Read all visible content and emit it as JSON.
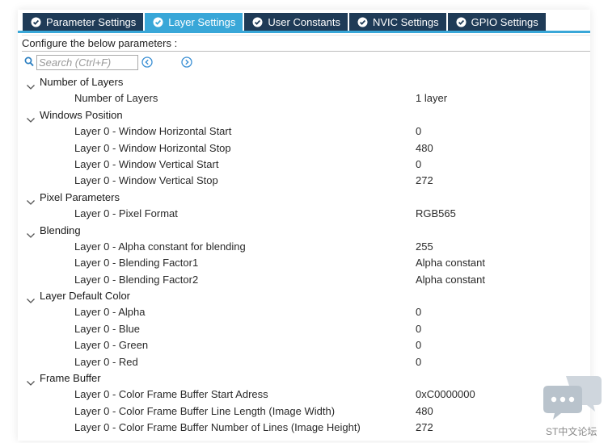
{
  "tabs": [
    {
      "label": "Parameter Settings",
      "active": false
    },
    {
      "label": "Layer Settings",
      "active": true
    },
    {
      "label": "User Constants",
      "active": false
    },
    {
      "label": "NVIC Settings",
      "active": false
    },
    {
      "label": "GPIO Settings",
      "active": false
    }
  ],
  "configure_text": "Configure the below parameters :",
  "search": {
    "placeholder": "Search (Ctrl+F)"
  },
  "groups": [
    {
      "title": "Number of Layers",
      "params": [
        {
          "label": "Number of Layers",
          "value": "1 layer"
        }
      ]
    },
    {
      "title": "Windows Position",
      "params": [
        {
          "label": "Layer 0 - Window Horizontal Start",
          "value": "0"
        },
        {
          "label": "Layer 0 - Window Horizontal Stop",
          "value": "480"
        },
        {
          "label": "Layer 0 - Window Vertical Start",
          "value": "0"
        },
        {
          "label": "Layer 0 - Window Vertical Stop",
          "value": "272"
        }
      ]
    },
    {
      "title": "Pixel Parameters",
      "params": [
        {
          "label": "Layer 0 - Pixel Format",
          "value": "RGB565"
        }
      ]
    },
    {
      "title": "Blending",
      "params": [
        {
          "label": "Layer 0 - Alpha constant for blending",
          "value": "255"
        },
        {
          "label": "Layer 0 - Blending Factor1",
          "value": "Alpha constant"
        },
        {
          "label": "Layer 0 - Blending Factor2",
          "value": "Alpha constant"
        }
      ]
    },
    {
      "title": "Layer Default Color",
      "params": [
        {
          "label": "Layer 0 - Alpha",
          "value": "0"
        },
        {
          "label": "Layer 0 - Blue",
          "value": "0"
        },
        {
          "label": "Layer 0 - Green",
          "value": "0"
        },
        {
          "label": "Layer 0 - Red",
          "value": "0"
        }
      ]
    },
    {
      "title": "Frame Buffer",
      "params": [
        {
          "label": "Layer 0 - Color Frame Buffer Start Adress",
          "value": "0xC0000000"
        },
        {
          "label": "Layer 0 - Color Frame Buffer Line Length (Image Width)",
          "value": "480"
        },
        {
          "label": "Layer 0 - Color Frame Buffer Number of Lines (Image Height)",
          "value": "272"
        }
      ]
    }
  ],
  "watermark": {
    "text": "ST中文论坛"
  },
  "colors": {
    "tab_bg": "#1f3b57",
    "tab_active": "#39a7d8",
    "accent": "#39a7d8"
  },
  "icons": {
    "tab": "check-circle-icon",
    "search": "search-icon",
    "prev": "previous-arrow-icon",
    "next": "next-arrow-icon",
    "group": "chevron-down-icon"
  }
}
